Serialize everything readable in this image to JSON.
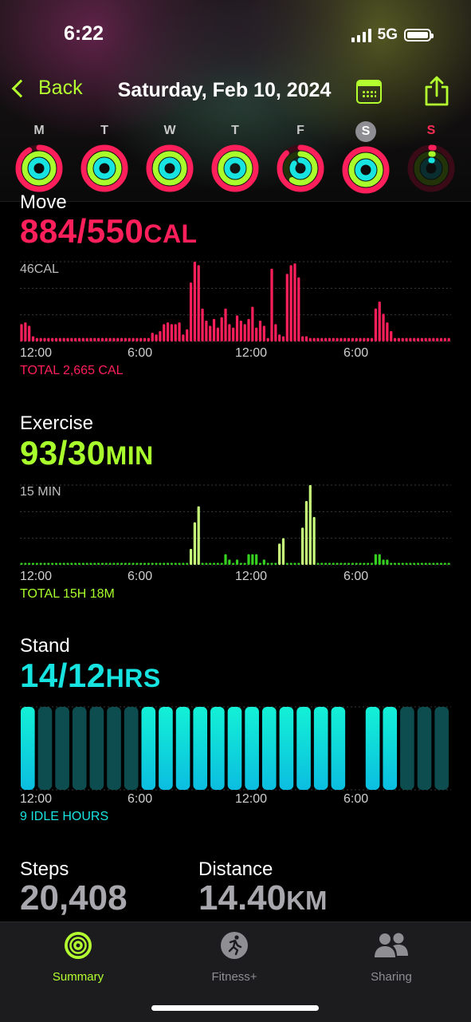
{
  "status": {
    "time": "6:22",
    "network": "5G"
  },
  "nav": {
    "back_label": "Back",
    "title": "Saturday, Feb 10, 2024"
  },
  "days": [
    {
      "label": "M",
      "move": 0.92,
      "exercise": 1.0,
      "stand": 1.0
    },
    {
      "label": "T",
      "move": 1.0,
      "exercise": 1.0,
      "stand": 1.0
    },
    {
      "label": "W",
      "move": 1.0,
      "exercise": 1.0,
      "stand": 1.0
    },
    {
      "label": "T",
      "move": 1.0,
      "exercise": 1.0,
      "stand": 1.0
    },
    {
      "label": "F",
      "move": 0.88,
      "exercise": 0.6,
      "stand": 0.85
    },
    {
      "label": "S",
      "move": 1.0,
      "exercise": 1.0,
      "stand": 1.0,
      "selected": true
    },
    {
      "label": "S",
      "move": 0.02,
      "exercise": 0.02,
      "stand": 0.02,
      "today": true
    }
  ],
  "move": {
    "title": "Move",
    "value": "884/550",
    "unit": "CAL",
    "axis_max_label": "46CAL",
    "total": "TOTAL 2,665 CAL",
    "color": "#ff1f5a"
  },
  "exercise": {
    "title": "Exercise",
    "value": "93/30",
    "unit": "MIN",
    "axis_max_label": "15 MIN",
    "total": "TOTAL 15H 18M",
    "color": "#a8ff2c"
  },
  "stand": {
    "title": "Stand",
    "value": "14/12",
    "unit": "HRS",
    "total": "9 IDLE HOURS",
    "color": "#17e3e0"
  },
  "time_ticks": [
    "12:00",
    "6:00",
    "12:00",
    "6:00"
  ],
  "steps": {
    "label": "Steps",
    "value": "20,408"
  },
  "distance": {
    "label": "Distance",
    "value": "14.40",
    "unit": "KM"
  },
  "tabs": [
    {
      "label": "Summary",
      "icon": "activity-rings-icon",
      "active": true
    },
    {
      "label": "Fitness+",
      "icon": "runner-icon"
    },
    {
      "label": "Sharing",
      "icon": "people-icon"
    }
  ],
  "chart_data": [
    {
      "type": "bar",
      "title": "Move",
      "ylabel": "46CAL",
      "ylim": [
        0,
        46
      ],
      "x_tick_labels": [
        "12:00",
        "6:00",
        "12:00",
        "6:00"
      ],
      "values": [
        10,
        11,
        9,
        3,
        2,
        2,
        2,
        2,
        2,
        2,
        2,
        2,
        2,
        2,
        2,
        2,
        2,
        2,
        2,
        2,
        2,
        2,
        2,
        2,
        2,
        2,
        2,
        2,
        2,
        2,
        2,
        2,
        2,
        2,
        5,
        4,
        6,
        10,
        11,
        10,
        10,
        11,
        4,
        7,
        34,
        46,
        44,
        19,
        12,
        9,
        13,
        8,
        14,
        19,
        10,
        8,
        15,
        12,
        10,
        13,
        20,
        8,
        12,
        9,
        2,
        42,
        10,
        4,
        3,
        39,
        44,
        45,
        37,
        3,
        3,
        2,
        2,
        2,
        2,
        2,
        2,
        2,
        2,
        2,
        2,
        2,
        2,
        2,
        2,
        2,
        2,
        2,
        19,
        23,
        16,
        11,
        6,
        2,
        2,
        2,
        2,
        2,
        2,
        2,
        2,
        2,
        2,
        2,
        2,
        2,
        2,
        2
      ]
    },
    {
      "type": "bar",
      "title": "Exercise",
      "ylabel": "15 MIN",
      "ylim": [
        0,
        15
      ],
      "x_tick_labels": [
        "12:00",
        "6:00",
        "12:00",
        "6:00"
      ],
      "values": [
        0,
        0,
        0,
        0,
        0,
        0,
        0,
        0,
        0,
        0,
        0,
        0,
        0,
        0,
        0,
        0,
        0,
        0,
        0,
        0,
        0,
        0,
        0,
        0,
        0,
        0,
        0,
        0,
        0,
        0,
        0,
        0,
        0,
        0,
        0,
        0,
        0,
        0,
        0,
        0,
        0,
        0,
        0,
        0,
        3,
        8,
        11,
        0,
        0,
        0,
        0,
        0,
        0,
        2,
        1,
        0,
        1,
        0,
        0,
        2,
        2,
        2,
        0,
        1,
        0,
        0,
        0,
        4,
        5,
        0,
        0,
        0,
        0,
        7,
        12,
        15,
        9,
        0,
        0,
        0,
        0,
        0,
        0,
        0,
        0,
        0,
        0,
        0,
        0,
        0,
        0,
        0,
        2,
        2,
        1,
        1,
        0,
        0,
        0,
        0,
        0,
        0,
        0,
        0,
        0,
        0,
        0,
        0,
        0,
        0,
        0,
        0
      ]
    },
    {
      "type": "bar",
      "title": "Stand",
      "x_tick_labels": [
        "12:00",
        "6:00",
        "12:00",
        "6:00"
      ],
      "values": [
        1,
        0,
        0,
        0,
        0,
        0,
        0,
        1,
        1,
        1,
        1,
        1,
        1,
        1,
        1,
        1,
        1,
        1,
        1,
        null,
        1,
        1,
        0,
        0,
        0
      ]
    }
  ]
}
